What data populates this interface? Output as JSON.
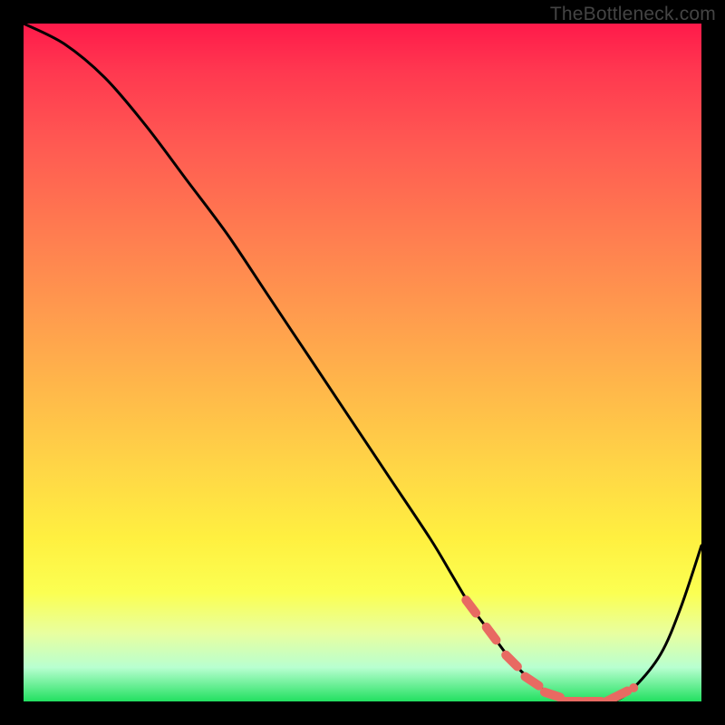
{
  "attribution": "TheBottleneck.com",
  "colors": {
    "curve": "#000000",
    "marker": "#e86a62",
    "frame": "#000000"
  },
  "chart_data": {
    "type": "line",
    "title": "",
    "xlabel": "",
    "ylabel": "",
    "xlim": [
      0,
      100
    ],
    "ylim": [
      0,
      100
    ],
    "curve": {
      "x": [
        0,
        6,
        12,
        18,
        24,
        30,
        36,
        42,
        48,
        54,
        60,
        63,
        66,
        69,
        72,
        75,
        78,
        81,
        84,
        87,
        90,
        94,
        97,
        100
      ],
      "y": [
        100,
        97,
        92,
        85,
        77,
        69,
        60,
        51,
        42,
        33,
        24,
        19,
        14,
        10,
        6,
        3,
        1,
        0,
        0,
        0,
        2,
        7,
        14,
        23
      ]
    },
    "highlight_points": {
      "x": [
        66,
        69,
        72,
        75,
        78,
        81,
        84,
        86,
        88,
        90
      ],
      "y": [
        14,
        10,
        6,
        3,
        1,
        0,
        0,
        0,
        1,
        2
      ]
    },
    "gradient_stops": [
      {
        "pos": 0.0,
        "color": "#ff1a4a"
      },
      {
        "pos": 0.18,
        "color": "#ff5a52"
      },
      {
        "pos": 0.42,
        "color": "#ff994e"
      },
      {
        "pos": 0.66,
        "color": "#ffd746"
      },
      {
        "pos": 0.84,
        "color": "#fbff52"
      },
      {
        "pos": 1.0,
        "color": "#22e060"
      }
    ]
  }
}
